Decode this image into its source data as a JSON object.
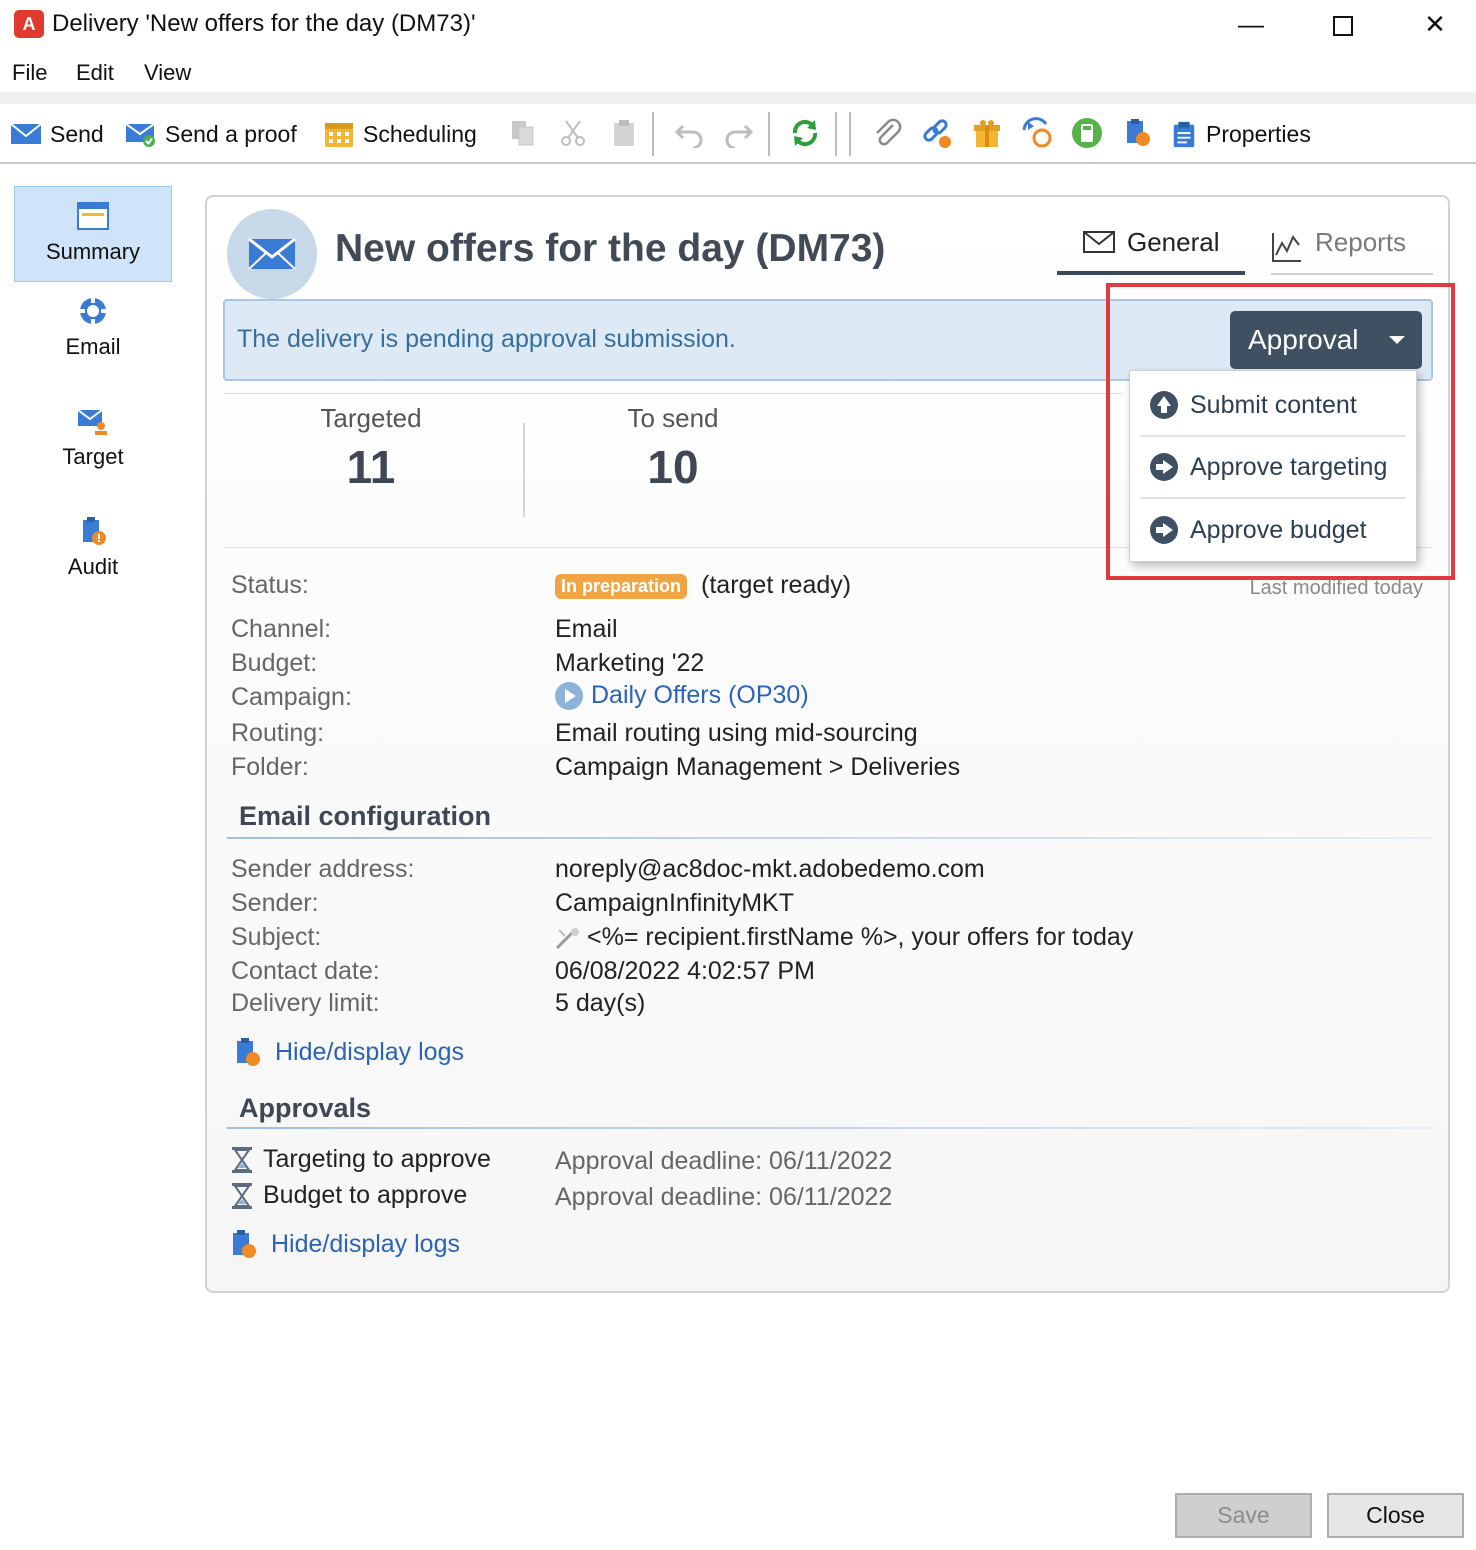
{
  "window": {
    "logo": "A",
    "title": "Delivery 'New offers for the day (DM73)'",
    "controls": {
      "minimize": "—",
      "close": "✕"
    }
  },
  "menu": [
    "File",
    "Edit",
    "View"
  ],
  "toolbar": {
    "send": "Send",
    "send_proof": "Send a proof",
    "scheduling": "Scheduling",
    "properties": "Properties"
  },
  "nav": [
    {
      "label": "Summary",
      "icon": "summary-icon"
    },
    {
      "label": "Email",
      "icon": "email-icon"
    },
    {
      "label": "Target",
      "icon": "target-icon"
    },
    {
      "label": "Audit",
      "icon": "audit-icon"
    }
  ],
  "header": {
    "title": "New offers for the day (DM73)",
    "tabs": {
      "general": "General",
      "reports": "Reports"
    }
  },
  "banner": {
    "message": "The delivery is pending approval submission.",
    "approval_button": "Approval"
  },
  "approval_menu": [
    "Submit content",
    "Approve targeting",
    "Approve budget"
  ],
  "stats": {
    "targeted_label": "Targeted",
    "targeted_value": "11",
    "to_send_label": "To send",
    "to_send_value": "10"
  },
  "last_modified": "Last modified today",
  "details": {
    "status_label": "Status:",
    "status_badge": "In preparation",
    "status_note": "(target ready)",
    "channel_label": "Channel:",
    "channel": "Email",
    "budget_label": "Budget:",
    "budget": "Marketing '22",
    "campaign_label": "Campaign:",
    "campaign": "Daily Offers (OP30)",
    "routing_label": "Routing:",
    "routing": "Email routing using mid-sourcing",
    "folder_label": "Folder:",
    "folder": "Campaign Management > Deliveries"
  },
  "email_config": {
    "title": "Email configuration",
    "sender_address_label": "Sender address:",
    "sender_address": "noreply@ac8doc-mkt.adobedemo.com",
    "sender_label": "Sender:",
    "sender": "CampaignInfinityMKT",
    "subject_label": "Subject:",
    "subject": "<%= recipient.firstName %>, your offers for today",
    "contact_date_label": "Contact date:",
    "contact_date": "06/08/2022 4:02:57 PM",
    "delivery_limit_label": "Delivery limit:",
    "delivery_limit": "5 day(s)",
    "logs_link": "Hide/display logs"
  },
  "approvals": {
    "title": "Approvals",
    "items": [
      {
        "label": "Targeting to approve",
        "deadline": "Approval deadline: 06/11/2022"
      },
      {
        "label": "Budget to approve",
        "deadline": "Approval deadline: 06/11/2022"
      }
    ],
    "logs_link": "Hide/display logs"
  },
  "footer": {
    "save": "Save",
    "close": "Close"
  },
  "colors": {
    "accent": "#3f5062",
    "highlight": "#e0393e",
    "badge": "#f0a444",
    "link": "#2a63b8"
  }
}
